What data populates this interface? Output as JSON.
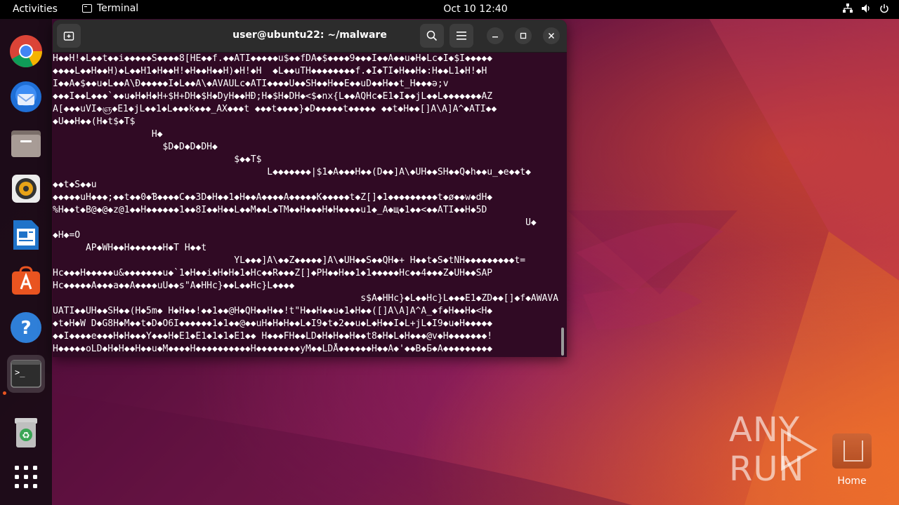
{
  "topbar": {
    "activities": "Activities",
    "app_name": "Terminal",
    "clock": "Oct 10  12:40"
  },
  "dock": {
    "items": [
      "chrome-icon",
      "thunderbird-icon",
      "files-icon",
      "rhythmbox-icon",
      "libreoffice-writer-icon",
      "app-center-icon",
      "help-icon",
      "terminal-icon",
      "trash-icon",
      "show-apps-icon"
    ]
  },
  "window": {
    "title": "user@ubuntu22: ~/malware",
    "lines": [
      "H◆◆H!◆L◆◆t◆◆i◆◆◆◆◆S◆◆◆◆8[HE◆◆f.◆◆ATI◆◆◆◆◆u$◆◆fDA◆$◆◆◆◆9◆◆◆I◆◆A◆◆u◆H◆Lc◆I◆$I◆◆◆◆◆",
      "◆◆◆◆L◆◆H◆◆H)◆L◆◆H1◆H◆◆H!◆H◆◆H◆◆H)◆H!◆H  ◆L◆◆uTH◆◆◆◆◆◆◆◆f.◆I◆TI◆H◆◆H◆:H◆◆L1◆H!◆H",
      "I◆◆A◆$◆◆u◆L◆◆A\\Ð◆◆◆◆◆I◆L◆◆A\\◆AVAULc◆ATI◆◆◆◆U◆◆SH◆◆H◆◆E◆◆uD◆◆H◆◆t_H◆◆◆ə;v",
      "◆◆◆I◆◆L◆◆◆`◆◆u◆H◆H◆H+$H+DH◆$H◆DyH◆◆HÐ;H◆$H◆DH◆<$◆nx{L◆◆AQHc◆E1◆I◆◆jL◆◆L◆◆◆◆◆◆◆AZ",
      "A[◆◆◆uVI◆ஞ◆E1◆jL◆◆1◆L◆◆◆k◆◆◆_AX◆◆◆t ◆◆◆t◆◆◆◆}◆D◆◆◆◆◆t◆◆◆◆◆ ◆◆t◆H◆◆[]A\\A]A^◆ATI◆◆",
      "◆U◆◆H◆◆(H◆t$◆T$",
      "                  H◆",
      "                    $D◆D◆D◆DH◆",
      "                                 $◆◆T$",
      "                                       L◆◆◆◆◆◆◆|$1◆A◆◆◆H◆◆(D◆◆]A\\◆UH◆◆SH◆◆Q◆h◆◆u_◆e◆◆t◆",
      "◆◆t◆S◆◆u",
      "◆◆◆◆◆uH◆◆◆;◆◆t◆◆0◆Ɓ◆◆◆◆C◆◆3D◆H◆◆1◆H◆◆A◆◆◆◆A◆◆◆◆◆K◆◆◆◆◆t◆Z[]◆1◆◆◆◆◆◆◆◆◆t◆ø◆◆w◆dH◆",
      "%H◆◆t◆B@◆@◆z@1◆◆H◆◆◆◆◆◆1◆◆8I◆◆H◆◆L◆◆M◆◆L◆TM◆◆H◆◆◆H◆H◆◆◆◆u1◆_A◆щ◆1◆◆<◆◆ATI◆◆H◆5D",
      "                                                                                      U◆",
      "◆H◆=O",
      "      AP◆WH◆◆H◆◆◆◆◆◆H◆T H◆◆t",
      "                                 YL◆◆◆]A\\◆◆Z◆◆◆◆◆]A\\◆UH◆◆S◆◆QH◆+ H◆◆t◆S◆tNH◆◆◆◆◆◆◆◆◆t=",
      "Hc◆◆◆H◆◆◆◆◆u&◆◆◆◆◆◆◆u◆`1◆H◆◆i◆H◆H◆1◆Hc◆◆R◆◆◆Z[]◆PH◆◆H◆◆1◆1◆◆◆◆◆Hc◆◆4◆◆◆Z◆UH◆◆SAP",
      "Hc◆◆◆◆◆A◆◆◆a◆◆A◆◆◆◆uU◆◆s\"A◆HHc}◆◆L◆◆Hc}L◆◆◆◆",
      "                                                        s$A◆HHc}◆L◆◆Hc}L◆◆◆E1◆ZD◆◆[]◆f◆AWAVA",
      "UATI◆◆UH◆◆SH◆◆(H◆5m◆ H◆H◆◆!◆◆1◆◆@H◆QH◆◆H◆◆!t\"H◆◆H◆◆u◆1◆H◆◆([]A\\A]A^A_◆f◆H◆◆H◆<H◆",
      "◆t◆H◆W D◆G8H◆M◆◆t◆D◆O6I◆◆◆◆◆◆1◆1◆◆@◆◆uH◆H◆H◆◆L◆I9◆t◆2◆◆u◆L◆H◆◆I◆L+jL◆I9◆u◆H◆◆◆◆◆",
      "◆◆I◆◆◆◆e◆◆◆H◆H◆◆◆Y◆◆◆H◆E1◆E1◆1◆1◆E1◆◆ H◆◆◆FH◆◆LD◆H◆H◆◆H◆◆t8◆H◆L◆H◆◆◆@v◆H◆◆◆◆◆◆◆!",
      "H◆◆◆◆◆oLD◆H◆H◆◆H◆◆u◆M◆◆◆◆H◆◆◆◆◆◆◆◆◆◆H◆◆◆◆◆◆◆◆yM◆◆LDÅ◆◆◆◆◆◆H◆◆A◆'◆◆B◆Б◆A◆◆◆◆◆◆◆◆◆"
    ]
  },
  "desktop": {
    "home_label": "Home",
    "watermark": "ANY RUN"
  }
}
